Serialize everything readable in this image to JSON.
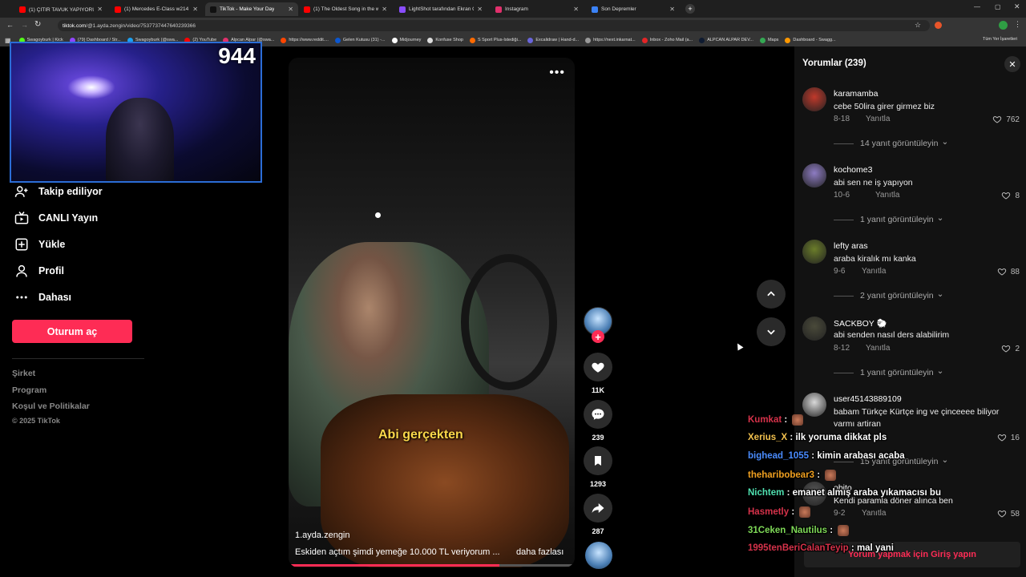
{
  "browser": {
    "tabs": [
      {
        "title": "(1) ÇITIR TAVUK YAPIYORUZ 🐔",
        "color": "#ff0000"
      },
      {
        "title": "(1) Mercedes E-Class w214 The",
        "color": "#ff0000"
      },
      {
        "title": "TikTok - Make Your Day",
        "color": "#111111"
      },
      {
        "title": "(1) The Oldest Song in the worl",
        "color": "#ff0000"
      },
      {
        "title": "LightShot tarafından Ekran Görü",
        "color": "#8a4dff"
      },
      {
        "title": "Instagram",
        "color": "#e1306c"
      },
      {
        "title": "Son Depremler",
        "color": "#3b82f6"
      }
    ],
    "url_host": "tiktok.com",
    "url_path": "/@1.ayda.zengin/video/7537737447640239366",
    "bookmarks": [
      "Swagoyburk | Kick",
      "(79) Dashboard / Str...",
      "Swagoyburk (@swa...",
      "(2) YouTube",
      "Alpcan Alpar (@swa...",
      "https://www.reddit....",
      "Gelen Kutusu (31) -...",
      "Midjourney",
      "Konfuse Shop",
      "S Sport Plus-İstediği...",
      "Excalidraw | Hand-d...",
      "https://next.inkarnat...",
      "Inbox - Zoho Mail (a...",
      "ALPCAN ALPAR DEV...",
      "Maps",
      "Dashboard - Swagg..."
    ],
    "all_bookmarks": "Tüm Yer İşaretleri"
  },
  "stream": {
    "viewer_count": "944"
  },
  "sidebar": {
    "items": [
      {
        "label": "Takip ediliyor",
        "icon": "following-icon"
      },
      {
        "label": "CANLI Yayın",
        "icon": "live-tv-icon"
      },
      {
        "label": "Yükle",
        "icon": "upload-icon"
      },
      {
        "label": "Profil",
        "icon": "profile-icon"
      },
      {
        "label": "Dahası",
        "icon": "more-icon"
      }
    ],
    "login_button": "Oturum aç",
    "footer": [
      "Şirket",
      "Program",
      "Koşul ve Politikalar",
      "© 2025 TikTok"
    ]
  },
  "video": {
    "caption_overlay": "Abi gerçekten",
    "author": "1.ayda.zengin",
    "description": "Eskiden açtım şimdi yemeğe 10.000 TL veriyorum ...",
    "more_link": "daha fazlası",
    "progress": 0.74,
    "likes": "11K",
    "comments": "239",
    "saves": "1293",
    "shares": "287"
  },
  "comments_panel": {
    "title": "Yorumlar (239)",
    "reply_label": "Yanıtla",
    "login_prompt": "Yorum yapmak için Giriş yapın",
    "items": [
      {
        "user": "karamamba",
        "text": "cebe 50lira girer girmez biz",
        "date": "8-18",
        "likes": "762",
        "more": "14 yanıt görüntüleyin",
        "avatar": "#c0392b"
      },
      {
        "user": "kochome3",
        "text": "abi sen ne iş yapıyon",
        "date": "10-6",
        "likes": "8",
        "more": "1 yanıt görüntüleyin",
        "avatar": "#8e7cc3"
      },
      {
        "user": "lefty aras",
        "text": "araba kiralık mı kanka",
        "date": "9-6",
        "likes": "88",
        "more": "2 yanıt görüntüleyin",
        "avatar": "#6b7d2a"
      },
      {
        "user": "SACKBOY 🐑",
        "text": "abi senden nasıl ders alabilirim",
        "date": "8-12",
        "likes": "2",
        "more": "1 yanıt görüntüleyin",
        "avatar": "#4a4a3a"
      },
      {
        "user": "user45143889109",
        "text": "babam Türkçe Kürtçe ing ve çinceeee biliyor varmı artiran",
        "date": "",
        "likes": "16",
        "more": "15 yanıt görüntüleyin",
        "avatar": "#d9d9d9"
      },
      {
        "user": "obito",
        "text": "Kendi paramla döner alınca ben",
        "date": "9-2",
        "likes": "58",
        "more": "",
        "avatar": "#555555"
      }
    ]
  },
  "chat": [
    {
      "user": "Kumkat",
      "message": "",
      "color": "#d6324a",
      "emote": true
    },
    {
      "user": "Xerius_X",
      "message": "ilk yoruma dikkat pls",
      "color": "#f2c14e",
      "emote": false
    },
    {
      "user": "bighead_1055",
      "message": "kimin arabası acaba",
      "color": "#4a8cff",
      "emote": false
    },
    {
      "user": "theharibobear3",
      "message": "",
      "color": "#f0a020",
      "emote": true
    },
    {
      "user": "Nichtem",
      "message": "emanet almış araba yıkamacısı bu",
      "color": "#4fe0b0",
      "emote": false
    },
    {
      "user": "Hasmetly",
      "message": "",
      "color": "#d6324a",
      "emote": true
    },
    {
      "user": "31Ceken_Nautilus",
      "message": "",
      "color": "#7ed957",
      "emote": true
    },
    {
      "user": "1995tenBeriCalanTeyip",
      "message": "mal yani",
      "color": "#d6324a",
      "emote": false
    }
  ]
}
